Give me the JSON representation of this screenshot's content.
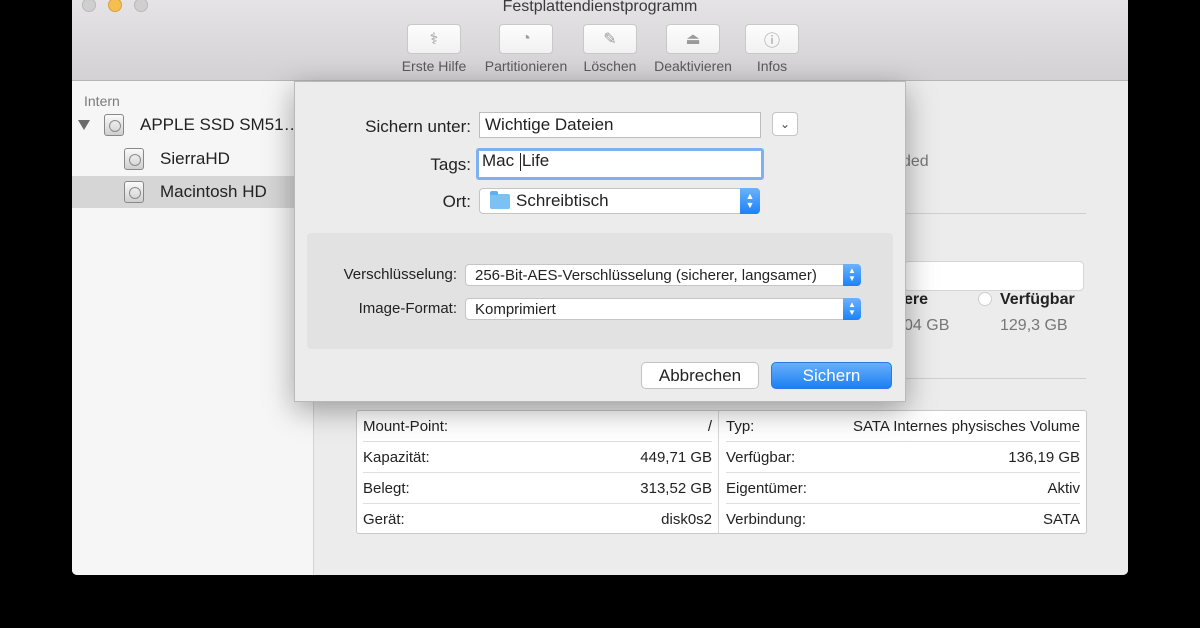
{
  "window": {
    "title": "Festplattendienstprogramm"
  },
  "toolbar": {
    "items": [
      {
        "label": "Erste Hilfe",
        "icon": "stethoscope-icon"
      },
      {
        "label": "Partitionieren",
        "icon": "pie-chart-icon"
      },
      {
        "label": "Löschen",
        "icon": "erase-icon"
      },
      {
        "label": "Deaktivieren",
        "icon": "eject-icon"
      },
      {
        "label": "Infos",
        "icon": "info-icon"
      }
    ]
  },
  "sidebar": {
    "section": "Intern",
    "items": [
      {
        "label": "APPLE SSD SM51…",
        "icon": "hard-disk-icon"
      },
      {
        "label": "SierraHD",
        "icon": "volume-icon"
      },
      {
        "label": "Macintosh HD",
        "icon": "volume-icon",
        "selected": true
      }
    ]
  },
  "main": {
    "fragment_format": "ded",
    "legend_other_fragment": "ere",
    "legend_other_value_fragment": "04 GB",
    "legend_available_label": "Verfügbar",
    "legend_available_value": "129,3 GB",
    "info_left": [
      {
        "label": "Mount-Point:",
        "value": "/"
      },
      {
        "label": "Kapazität:",
        "value": "449,71 GB"
      },
      {
        "label": "Belegt:",
        "value": "313,52 GB"
      },
      {
        "label": "Gerät:",
        "value": "disk0s2"
      }
    ],
    "info_right": [
      {
        "label": "Typ:",
        "value": "SATA Internes physisches Volume"
      },
      {
        "label": "Verfügbar:",
        "value": "136,19 GB"
      },
      {
        "label": "Eigentümer:",
        "value": "Aktiv"
      },
      {
        "label": "Verbindung:",
        "value": "SATA"
      }
    ]
  },
  "dialog": {
    "save_as_label": "Sichern unter:",
    "save_as_value": "Wichtige Dateien",
    "tags_label": "Tags:",
    "tags_value_before": "Mac ",
    "tags_value_after": "Life",
    "location_label": "Ort:",
    "location_value": "Schreibtisch",
    "encryption_label": "Verschlüsselung:",
    "encryption_value": "256-Bit-AES-Verschlüsselung (sicherer, langsamer)",
    "format_label": "Image-Format:",
    "format_value": "Komprimiert",
    "cancel_label": "Abbrechen",
    "save_label": "Sichern"
  },
  "colors": {
    "accent": "#1c7ff3",
    "focus_ring": "#7fb0f0",
    "minimize": "#f5bf4f"
  }
}
